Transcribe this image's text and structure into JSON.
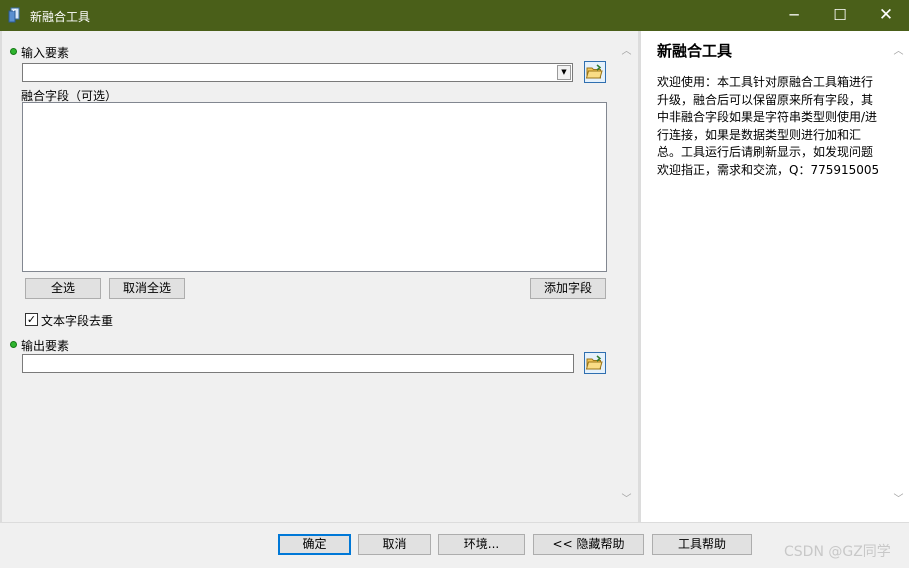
{
  "window": {
    "title": "新融合工具",
    "minimize": "─",
    "maximize": "☐",
    "close": "✕"
  },
  "form": {
    "input_features": {
      "label": "输入要素",
      "value": ""
    },
    "dissolve_fields": {
      "label": "融合字段（可选）",
      "items": []
    },
    "buttons": {
      "select_all": "全选",
      "unselect_all": "取消全选",
      "add_field": "添加字段"
    },
    "dedup_checkbox": {
      "label": "文本字段去重",
      "checked": true,
      "mark": "✓"
    },
    "output_features": {
      "label": "输出要素",
      "value": ""
    }
  },
  "scroll": {
    "up": "︿",
    "down": "﹀"
  },
  "help": {
    "title": "新融合工具",
    "text": "欢迎使用：本工具针对原融合工具箱进行升级，融合后可以保留原来所有字段，其中非融合字段如果是字符串类型则使用/进行连接，如果是数据类型则进行加和汇总。工具运行后请刷新显示，如发现问题欢迎指正，需求和交流，Q：775915005"
  },
  "footer": {
    "ok": "确定",
    "cancel": "取消",
    "environments": "环境...",
    "hide_help": "<< 隐藏帮助",
    "tool_help": "工具帮助"
  },
  "watermark": "CSDN @GZ同学"
}
